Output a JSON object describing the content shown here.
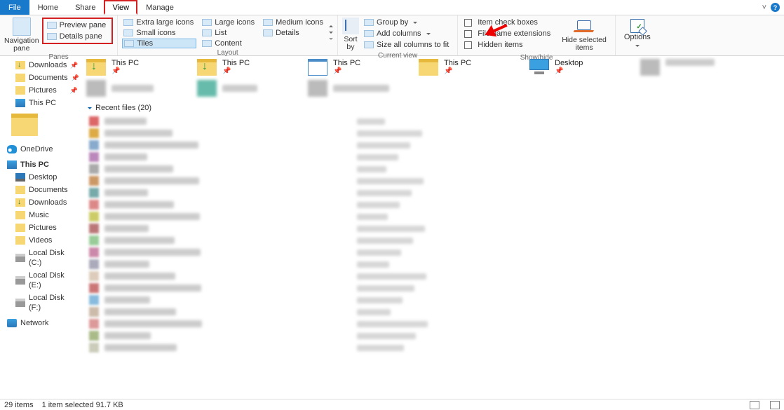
{
  "tabs": {
    "file": "File",
    "home": "Home",
    "share": "Share",
    "view": "View",
    "manage": "Manage"
  },
  "panes": {
    "navigation": "Navigation\npane",
    "preview": "Preview pane",
    "details": "Details pane",
    "group_label": "Panes"
  },
  "layout": {
    "extra_large": "Extra large icons",
    "large": "Large icons",
    "medium": "Medium icons",
    "small": "Small icons",
    "list": "List",
    "details": "Details",
    "tiles": "Tiles",
    "content": "Content",
    "group_label": "Layout"
  },
  "currentview": {
    "sort_by": "Sort\nby",
    "group_by": "Group by",
    "add_columns": "Add columns",
    "size_cols": "Size all columns to fit",
    "group_label": "Current view"
  },
  "showhide": {
    "item_check": "Item check boxes",
    "file_ext": "File name extensions",
    "hidden": "Hidden items",
    "hide_selected": "Hide selected\nitems",
    "group_label": "Show/hide"
  },
  "options_label": "Options",
  "quickaccess": [
    {
      "name": "Downloads"
    },
    {
      "name": "Documents"
    },
    {
      "name": "Pictures"
    },
    {
      "name": "This PC"
    }
  ],
  "quickaccess_tiles": {
    "thispc": "This PC",
    "desktop": "Desktop"
  },
  "recent_header": "Recent files (20)",
  "nav": {
    "onedrive": "OneDrive",
    "thispc": "This PC",
    "desktop": "Desktop",
    "documents": "Documents",
    "downloads": "Downloads",
    "music": "Music",
    "pictures": "Pictures",
    "videos": "Videos",
    "local_c": "Local Disk (C:)",
    "local_e": "Local Disk (E:)",
    "local_f": "Local Disk (F:)",
    "network": "Network"
  },
  "status": {
    "items": "29 items",
    "selected": "1 item selected  91.7 KB"
  },
  "chevron_min": "˅"
}
